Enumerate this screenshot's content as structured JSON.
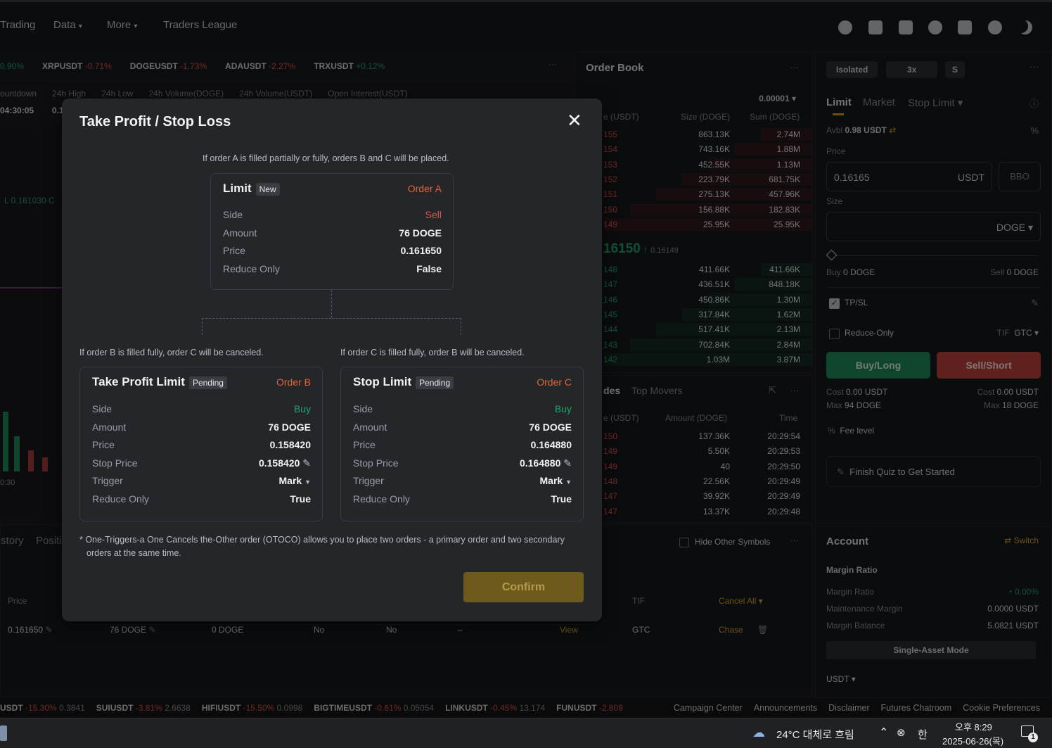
{
  "nav": {
    "items": [
      "Trading",
      "Data",
      "More",
      "Traders League"
    ]
  },
  "header_icons": [
    "user-icon",
    "wallet-icon",
    "building-icon",
    "globe-icon",
    "help-icon",
    "gear-icon",
    "moon-icon"
  ],
  "tickers": [
    {
      "sym": "",
      "chg": "0.90%",
      "color": "green"
    },
    {
      "sym": "XRPUSDT",
      "chg": "-0.71%",
      "color": "red"
    },
    {
      "sym": "DOGEUSDT",
      "chg": "-1.73%",
      "color": "red"
    },
    {
      "sym": "ADAUSDT",
      "chg": "-2.27%",
      "color": "red"
    },
    {
      "sym": "TRXUSDT",
      "chg": "+0.12%",
      "color": "green"
    }
  ],
  "stats_headers": [
    "ountdown",
    "24h High",
    "24h Low",
    "24h Volume(DOGE)",
    "24h Volume(USDT)",
    "Open Interest(USDT)"
  ],
  "stats_values": [
    "04:30:05",
    "0.1"
  ],
  "chart_label": "L 0.161030 C",
  "chart_time": "0:30",
  "order_book": {
    "title": "Order Book",
    "precision": "0.00001",
    "headers": [
      "e (USDT)",
      "Size (DOGE)",
      "Sum (DOGE)"
    ],
    "asks": [
      {
        "p": "155",
        "s": "863.13K",
        "t": "2.74M"
      },
      {
        "p": "154",
        "s": "743.16K",
        "t": "1.88M"
      },
      {
        "p": "153",
        "s": "452.55K",
        "t": "1.13M"
      },
      {
        "p": "152",
        "s": "223.79K",
        "t": "681.75K"
      },
      {
        "p": "151",
        "s": "275.13K",
        "t": "457.96K"
      },
      {
        "p": "150",
        "s": "156.88K",
        "t": "182.83K"
      },
      {
        "p": "149",
        "s": "25.95K",
        "t": "25.95K"
      }
    ],
    "last": "16150",
    "mark": "0.16149",
    "bids": [
      {
        "p": "148",
        "s": "411.66K",
        "t": "411.66K"
      },
      {
        "p": "147",
        "s": "436.51K",
        "t": "848.18K"
      },
      {
        "p": "146",
        "s": "450.86K",
        "t": "1.30M"
      },
      {
        "p": "145",
        "s": "317.84K",
        "t": "1.62M"
      },
      {
        "p": "144",
        "s": "517.41K",
        "t": "2.13M"
      },
      {
        "p": "143",
        "s": "702.84K",
        "t": "2.84M"
      },
      {
        "p": "142",
        "s": "1.03M",
        "t": "3.87M"
      }
    ]
  },
  "trades": {
    "tabs": [
      "des",
      "Top Movers"
    ],
    "headers": [
      "e (USDT)",
      "Amount (DOGE)",
      "Time"
    ],
    "rows": [
      {
        "p": "150",
        "a": "137.36K",
        "t": "20:29:54"
      },
      {
        "p": "149",
        "a": "5.50K",
        "t": "20:29:53"
      },
      {
        "p": "149",
        "a": "40",
        "t": "20:29:50"
      },
      {
        "p": "148",
        "a": "22.56K",
        "t": "20:29:49"
      },
      {
        "p": "147",
        "a": "39.92K",
        "t": "20:29:49"
      },
      {
        "p": "147",
        "a": "13.37K",
        "t": "20:29:48"
      }
    ]
  },
  "order_form": {
    "margin_mode": "Isolated",
    "leverage": "3x",
    "asset": "S",
    "tabs": [
      "Limit",
      "Market",
      "Stop Limit"
    ],
    "avbl_label": "Avbl",
    "avbl": "0.98 USDT",
    "price_label": "Price",
    "price": "0.16165",
    "price_unit": "USDT",
    "bbo": "BBO",
    "size_label": "Size",
    "size_unit": "DOGE",
    "buy_label": "Buy",
    "buy_amt": "0 DOGE",
    "sell_label": "Sell",
    "sell_amt": "0 DOGE",
    "tpsl": "TP/SL",
    "reduce_only": "Reduce-Only",
    "tif_label": "TIF",
    "tif": "GTC",
    "buy_btn": "Buy/Long",
    "sell_btn": "Sell/Short",
    "cost_label": "Cost",
    "cost_buy": "0.00 USDT",
    "cost_sell": "0.00 USDT",
    "max_label": "Max",
    "max_buy": "94 DOGE",
    "max_sell": "18 DOGE",
    "fee_level": "Fee level",
    "quiz": "Finish Quiz to Get Started"
  },
  "account": {
    "title": "Account",
    "switch": "Switch",
    "margin_ratio_title": "Margin Ratio",
    "margin_ratio_label": "Margin Ratio",
    "margin_ratio": "0.00%",
    "maint_label": "Maintenance Margin",
    "maint": "0.0000 USDT",
    "balance_label": "Margin Balance",
    "balance": "5.0821 USDT",
    "mode_btn": "Single-Asset Mode",
    "currency": "USDT"
  },
  "orders_panel": {
    "tabs": [
      "story",
      "Positi"
    ],
    "hide_other": "Hide Other Symbols",
    "headers": [
      "Price",
      "TIF"
    ],
    "cancel_all": "Cancel All",
    "row": {
      "price": "0.161650",
      "amount": "76 DOGE",
      "filled": "0 DOGE",
      "c1": "No",
      "c2": "No",
      "c3": "–",
      "view": "View",
      "tif": "GTC",
      "chase": "Chase"
    }
  },
  "modal": {
    "title": "Take Profit / Stop Loss",
    "top_note": "If order A is filled partially or fully, orders B and C will be placed.",
    "order_a": {
      "title": "Limit",
      "badge": "New",
      "tag": "Order A",
      "rows": [
        {
          "label": "Side",
          "value": "Sell"
        },
        {
          "label": "Amount",
          "value": "76 DOGE"
        },
        {
          "label": "Price",
          "value": "0.161650"
        },
        {
          "label": "Reduce Only",
          "value": "False"
        }
      ]
    },
    "note_b": "If order B is filled fully, order C will be canceled.",
    "note_c": "If order C is filled fully, order B will be canceled.",
    "order_b": {
      "title": "Take Profit Limit",
      "badge": "Pending",
      "tag": "Order B",
      "rows": [
        {
          "label": "Side",
          "value": "Buy"
        },
        {
          "label": "Amount",
          "value": "76 DOGE"
        },
        {
          "label": "Price",
          "value": "0.158420"
        },
        {
          "label": "Stop Price",
          "value": "0.158420"
        },
        {
          "label": "Trigger",
          "value": "Mark"
        },
        {
          "label": "Reduce Only",
          "value": "True"
        }
      ]
    },
    "order_c": {
      "title": "Stop Limit",
      "badge": "Pending",
      "tag": "Order C",
      "rows": [
        {
          "label": "Side",
          "value": "Buy"
        },
        {
          "label": "Amount",
          "value": "76 DOGE"
        },
        {
          "label": "Price",
          "value": "0.164880"
        },
        {
          "label": "Stop Price",
          "value": "0.164880"
        },
        {
          "label": "Trigger",
          "value": "Mark"
        },
        {
          "label": "Reduce Only",
          "value": "True"
        }
      ]
    },
    "footnote_1": "* One-Triggers-a One Cancels the-Other order (OTOCO) allows you to place two orders - a primary order and two secondary",
    "footnote_2": "orders at the same time.",
    "confirm": "Confirm",
    "colors": {
      "sell": "#e0504a",
      "buy": "#1fa56d",
      "tag": "#e0663a",
      "confirm_bg": "#6e5b1c"
    }
  },
  "bottom_tickers": [
    {
      "sym": "USDT",
      "chg": "-15.30%",
      "px": "0.3841"
    },
    {
      "sym": "SUIUSDT",
      "chg": "-3.81%",
      "px": "2.6638"
    },
    {
      "sym": "HIFIUSDT",
      "chg": "-15.50%",
      "px": "0.0998"
    },
    {
      "sym": "BIGTIMEUSDT",
      "chg": "-0.61%",
      "px": "0.05054"
    },
    {
      "sym": "LINKUSDT",
      "chg": "-0.45%",
      "px": "13.174"
    },
    {
      "sym": "FUNUSDT",
      "chg": "-2.809",
      "px": ""
    }
  ],
  "footer_links": [
    "Campaign Center",
    "Announcements",
    "Disclaimer",
    "Futures Chatroom",
    "Cookie Preferences"
  ],
  "taskbar": {
    "weather": "24°C 대체로 흐림",
    "time": "오후 8:29",
    "date": "2025-06-26(목)",
    "ime": "한",
    "notif": "1"
  }
}
